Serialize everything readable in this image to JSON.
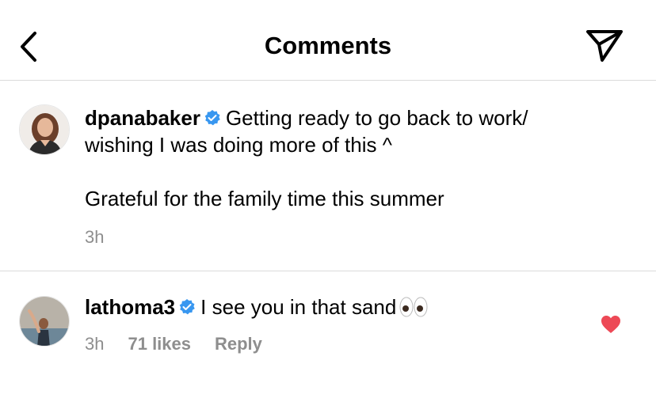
{
  "header": {
    "title": "Comments"
  },
  "caption": {
    "username": "dpanabaker",
    "text_line1": "Getting ready to go back to work/",
    "text_line2": "wishing I was doing more of this ^",
    "text_para2": "Grateful for the family time this summer",
    "time": "3h"
  },
  "comments": [
    {
      "username": "lathoma3",
      "text": "I see you in that sand",
      "emoji": "eyes-emoji",
      "time": "3h",
      "likes": "71 likes",
      "reply_label": "Reply",
      "liked": true
    }
  ],
  "colors": {
    "verified": "#3897f0",
    "heart": "#ed4956",
    "meta": "#8e8e8e",
    "divider": "#dbdbdb"
  }
}
